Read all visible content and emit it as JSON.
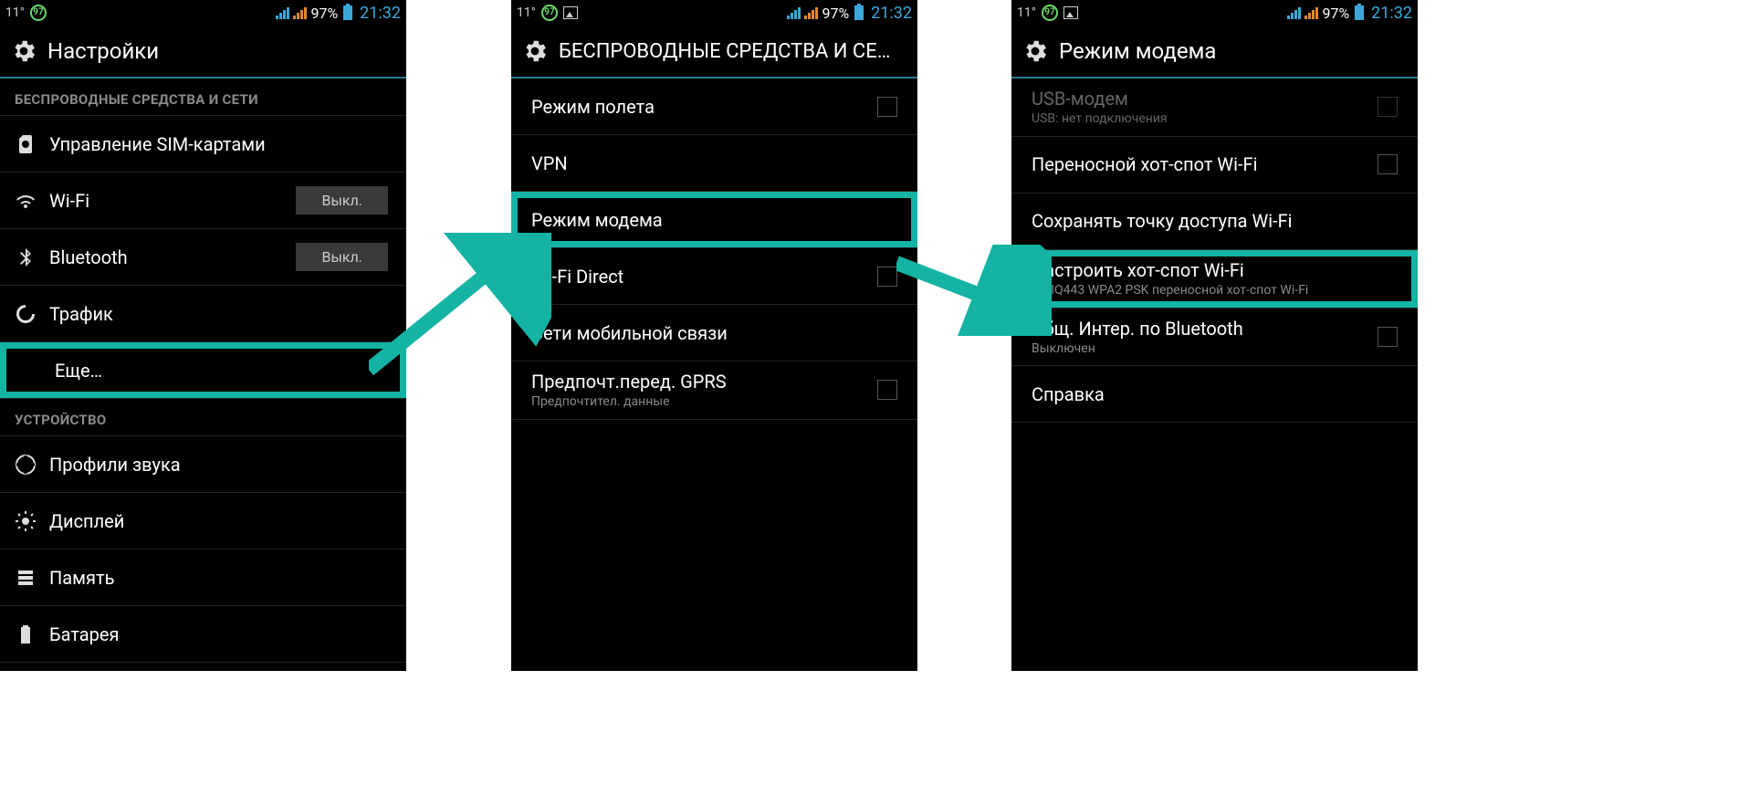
{
  "status": {
    "temp": "11°",
    "badge": "97",
    "battery_pct": "97%",
    "clock": "21:32"
  },
  "screen1": {
    "title": "Настройки",
    "section_wireless": "БЕСПРОВОДНЫЕ СРЕДСТВА И СЕТИ",
    "sim": "Управление SIM-картами",
    "wifi": "Wi-Fi",
    "wifi_toggle": "Выкл.",
    "bt": "Bluetooth",
    "bt_toggle": "Выкл.",
    "traffic": "Трафик",
    "more": "Еще…",
    "section_device": "УСТРОЙСТВО",
    "sound": "Профили звука",
    "display": "Дисплей",
    "storage": "Память",
    "battery": "Батарея"
  },
  "screen2": {
    "title": "БЕСПРОВОДНЫЕ СРЕДСТВА И СЕ…",
    "airplane": "Режим полета",
    "vpn": "VPN",
    "tether": "Режим модема",
    "wifi_direct": "Wi-Fi Direct",
    "mobile": "Сети мобильной связи",
    "gprs": "Предпочт.перед. GPRS",
    "gprs_sub": "Предпочтител. данные"
  },
  "screen3": {
    "title": "Режим модема",
    "usb": "USB-модем",
    "usb_sub": "USB: нет подключения",
    "hotspot": "Переносной хот-спот Wi-Fi",
    "keep": "Сохранять точку доступа Wi-Fi",
    "configure": "Настроить хот-спот Wi-Fi",
    "configure_sub": "Fly IQ443 WPA2 PSK переносной хот-спот Wi-Fi",
    "bt_share": "Общ. Интер. по Bluetooth",
    "bt_share_sub": "Выключен",
    "help": "Справка"
  }
}
